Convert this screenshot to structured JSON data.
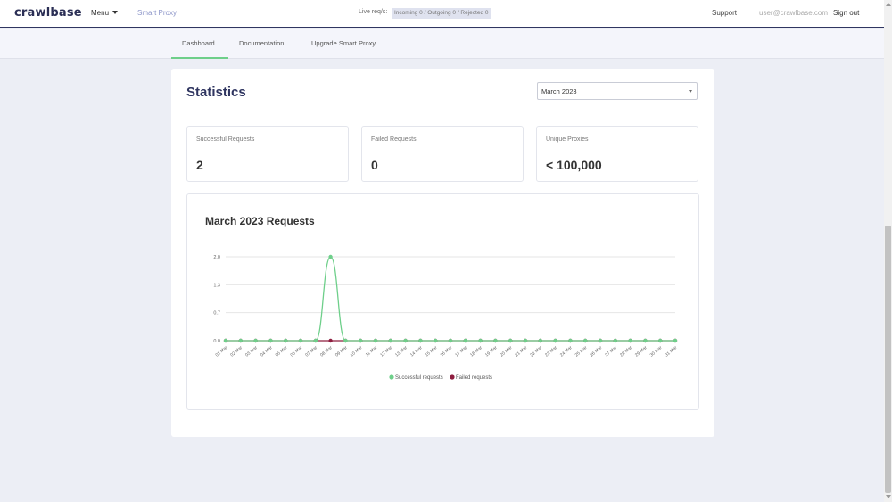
{
  "header": {
    "logo": "crawlbase",
    "menu_label": "Menu",
    "product_label": "Smart Proxy",
    "live_label": "Live req/s:",
    "live_stats": "Incoming 0 / Outgoing 0 / Rejected 0",
    "support": "Support",
    "email": "user@crawlbase.com",
    "sign_out": "Sign out"
  },
  "tabs": [
    {
      "label": "Dashboard",
      "active": true
    },
    {
      "label": "Documentation",
      "active": false
    },
    {
      "label": "Upgrade Smart Proxy",
      "active": false
    }
  ],
  "stats": {
    "title": "Statistics",
    "period": "March 2023",
    "cards": [
      {
        "label": "Successful Requests",
        "value": "2"
      },
      {
        "label": "Failed Requests",
        "value": "0"
      },
      {
        "label": "Unique Proxies",
        "value": "< 100,000"
      }
    ]
  },
  "colors": {
    "accent": "#2f3560",
    "success": "#6ecf8a",
    "failed": "#8e1d3f",
    "active_tab": "#6ecf8a"
  },
  "chart_data": {
    "type": "line",
    "title": "March 2023 Requests",
    "categories": [
      "01 Mar",
      "02 Mar",
      "03 Mar",
      "04 Mar",
      "05 Mar",
      "06 Mar",
      "07 Mar",
      "08 Mar",
      "09 Mar",
      "10 Mar",
      "11 Mar",
      "12 Mar",
      "13 Mar",
      "14 Mar",
      "15 Mar",
      "16 Mar",
      "17 Mar",
      "18 Mar",
      "19 Mar",
      "20 Mar",
      "21 Mar",
      "22 Mar",
      "23 Mar",
      "24 Mar",
      "25 Mar",
      "26 Mar",
      "27 Mar",
      "28 Mar",
      "29 Mar",
      "30 Mar",
      "31 Mar"
    ],
    "y_ticks": [
      "0.0",
      "0.7",
      "1.3",
      "2.0"
    ],
    "ylim": [
      0,
      2
    ],
    "grid": true,
    "legend": "bottom",
    "series": [
      {
        "name": "Successful requests",
        "color": "#6ecf8a",
        "values": [
          0,
          0,
          0,
          0,
          0,
          0,
          0,
          2,
          0,
          0,
          0,
          0,
          0,
          0,
          0,
          0,
          0,
          0,
          0,
          0,
          0,
          0,
          0,
          0,
          0,
          0,
          0,
          0,
          0,
          0,
          0
        ]
      },
      {
        "name": "Failed requests",
        "color": "#8e1d3f",
        "values": [
          0,
          0,
          0,
          0,
          0,
          0,
          0,
          0,
          0,
          0,
          0,
          0,
          0,
          0,
          0,
          0,
          0,
          0,
          0,
          0,
          0,
          0,
          0,
          0,
          0,
          0,
          0,
          0,
          0,
          0,
          0
        ]
      }
    ]
  }
}
